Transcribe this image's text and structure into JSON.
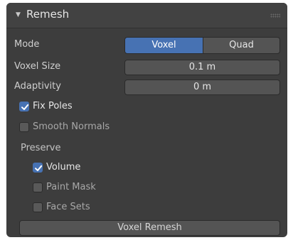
{
  "panel": {
    "title": "Remesh",
    "collapse_icon": "triangle-down-icon",
    "drag_icon": "drag-handle-icon"
  },
  "mode": {
    "label": "Mode",
    "options": [
      "Voxel",
      "Quad"
    ],
    "selected": "Voxel"
  },
  "voxel_size": {
    "label": "Voxel Size",
    "value": "0.1 m"
  },
  "adaptivity": {
    "label": "Adaptivity",
    "value": "0 m"
  },
  "fix_poles": {
    "label": "Fix Poles",
    "checked": true
  },
  "smooth_normals": {
    "label": "Smooth Normals",
    "checked": false
  },
  "preserve": {
    "label": "Preserve",
    "volume": {
      "label": "Volume",
      "checked": true
    },
    "paint_mask": {
      "label": "Paint Mask",
      "checked": false
    },
    "face_sets": {
      "label": "Face Sets",
      "checked": false
    }
  },
  "operator": {
    "label": "Voxel Remesh"
  },
  "colors": {
    "accent": "#4772b3",
    "panel_bg": "#3d3d3d",
    "field_bg": "#545454"
  }
}
